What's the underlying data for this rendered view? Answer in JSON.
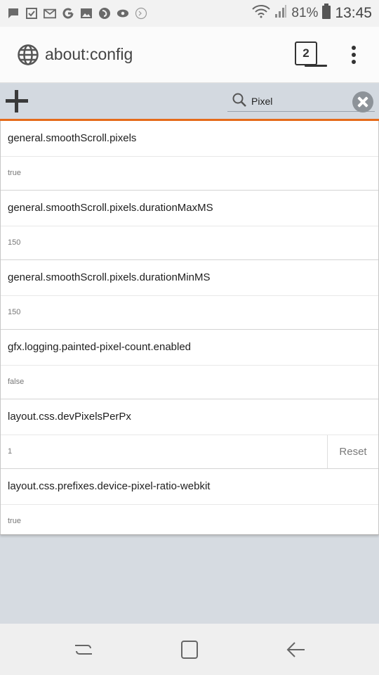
{
  "status_bar": {
    "battery_pct": "81%",
    "time": "13:45"
  },
  "url_bar": {
    "url": "about:config",
    "tab_count": "2"
  },
  "search": {
    "value": "Pixel"
  },
  "prefs": [
    {
      "name": "general.smoothScroll.pixels",
      "value": "true"
    },
    {
      "name": "general.smoothScroll.pixels.durationMaxMS",
      "value": "150"
    },
    {
      "name": "general.smoothScroll.pixels.durationMinMS",
      "value": "150"
    },
    {
      "name": "gfx.logging.painted-pixel-count.enabled",
      "value": "false"
    },
    {
      "name": "layout.css.devPixelsPerPx",
      "value": "1",
      "reset_label": "Reset"
    },
    {
      "name": "layout.css.prefixes.device-pixel-ratio-webkit",
      "value": "true"
    }
  ],
  "colors": {
    "accent": "#e66b1a",
    "toolbar": "#d3d9e0"
  }
}
